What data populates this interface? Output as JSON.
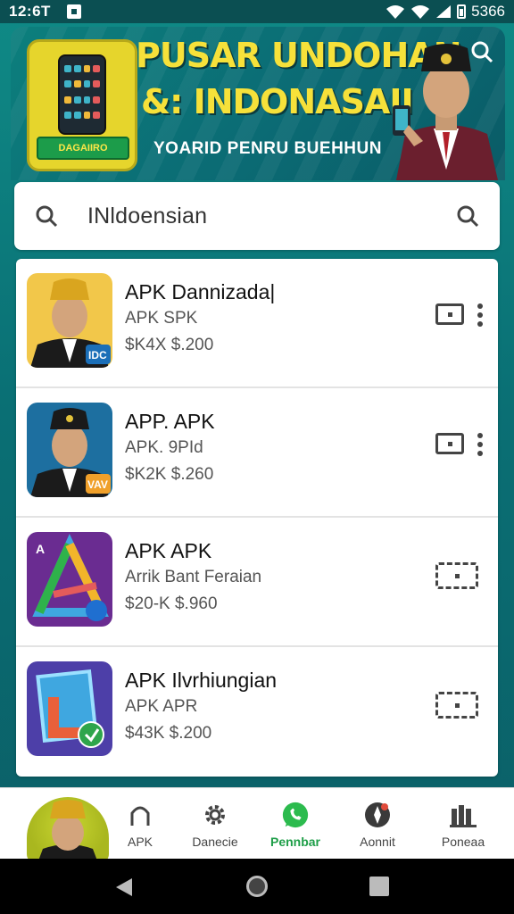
{
  "status_bar": {
    "time": "12:6T",
    "right_text": "5366"
  },
  "banner": {
    "title_line1": "PUSAR UNDOHAN",
    "title_line2": "&: INDONASAII",
    "subtitle": "YOARID PENRU BUEHHUN",
    "download_badge": "DAGAIIRO"
  },
  "search": {
    "query": "INldoensian"
  },
  "apps": [
    {
      "name": "APK Dannizada|",
      "sub": "APK SPK",
      "price": "$K4X  $.200",
      "badge": "IDC",
      "action": "download-box",
      "has_more": true
    },
    {
      "name": "APP. APK",
      "sub": "APK. 9PId",
      "price": "$K2K  $.260",
      "badge": "VAV",
      "action": "download-box",
      "has_more": true
    },
    {
      "name": "APK APK",
      "sub": "Arrik Bant Feraian",
      "price": "$20-K  $.960",
      "badge": "",
      "action": "ticket",
      "has_more": false
    },
    {
      "name": "APK Ilvrhiungian",
      "sub": "APK APR",
      "price": "$43K  $.200",
      "badge": "",
      "action": "ticket",
      "has_more": false
    }
  ],
  "bottom_nav": {
    "items": [
      {
        "label": "APK",
        "icon": "home-icon"
      },
      {
        "label": "Danecie",
        "icon": "gear-icon"
      },
      {
        "label": "Pennbar",
        "icon": "whatsapp-icon",
        "active": true
      },
      {
        "label": "Aonnit",
        "icon": "compass-icon"
      },
      {
        "label": "Poneaa",
        "icon": "books-icon"
      }
    ]
  },
  "colors": {
    "teal_bg": "#0b6f74",
    "banner_title": "#f6e13a",
    "active_nav": "#1e9e48"
  }
}
